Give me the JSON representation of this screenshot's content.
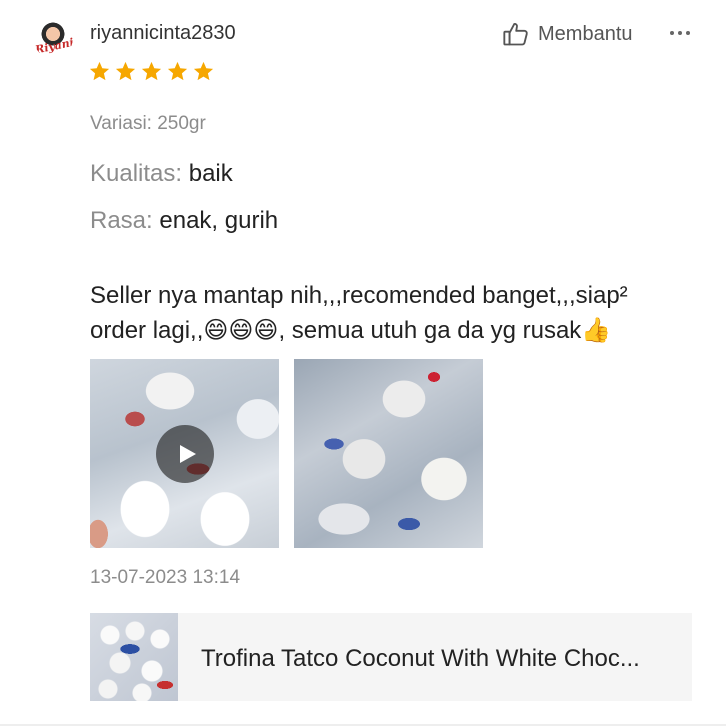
{
  "reviewer": {
    "username": "riyannicinta2830",
    "avatar_text": "Riyani"
  },
  "rating": {
    "value": 5,
    "max": 5,
    "star_color": "#f6a700"
  },
  "actions": {
    "helpful_label": "Membantu",
    "helpful_icon": "thumbs-up-icon",
    "more_icon": "more-dots-icon"
  },
  "variant": "Variasi: 250gr",
  "attributes": [
    {
      "key": "Kualitas:",
      "value": "baik"
    },
    {
      "key": "Rasa:",
      "value": "enak, gurih"
    }
  ],
  "review_text": "Seller nya mantap nih,,,recomended banget,,,siap² order lagi,,😄😄😄, semua utuh ga da yg rusak👍",
  "media": [
    {
      "type": "video",
      "icon": "play-icon"
    },
    {
      "type": "image"
    }
  ],
  "timestamp": "13-07-2023 13:14",
  "product": {
    "name": "Trofina Tatco Coconut With White Choc..."
  }
}
